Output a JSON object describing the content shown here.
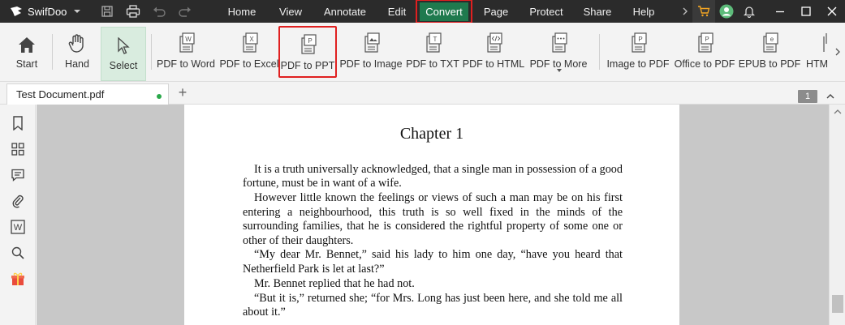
{
  "app": {
    "name": "SwifDoo"
  },
  "menu": {
    "items": [
      {
        "label": "Home"
      },
      {
        "label": "View"
      },
      {
        "label": "Annotate"
      },
      {
        "label": "Edit"
      },
      {
        "label": "Convert",
        "active": true
      },
      {
        "label": "Page"
      },
      {
        "label": "Protect"
      },
      {
        "label": "Share"
      },
      {
        "label": "Help"
      }
    ]
  },
  "ribbon": {
    "start": "Start",
    "hand": "Hand",
    "select": "Select",
    "pdf_to_word": "PDF to Word",
    "pdf_to_excel": "PDF to Excel",
    "pdf_to_ppt": "PDF to PPT",
    "pdf_to_image": "PDF to Image",
    "pdf_to_txt": "PDF to TXT",
    "pdf_to_html": "PDF to HTML",
    "pdf_to_more": "PDF to More",
    "image_to_pdf": "Image to PDF",
    "office_to_pdf": "Office to PDF",
    "epub_to_pdf": "EPUB to PDF",
    "html": "HTM"
  },
  "tabs": {
    "document_tab": "Test Document.pdf",
    "add_tab": "+",
    "page_number": "1"
  },
  "document": {
    "chapter_title": "Chapter 1",
    "paragraphs": [
      "It is a truth universally acknowledged, that a single man in possession of a good fortune, must be in want of a wife.",
      "However little known the feelings or views of such a man may be on his first entering a neighbourhood, this truth is so well fixed in the minds of the surrounding families, that he is considered the rightful property of some one or other of their daughters.",
      "“My dear Mr. Bennet,” said his lady to him one day, “have you heard that Netherfield Park is let at last?”",
      "Mr. Bennet replied that he had not.",
      "“But it is,” returned she; “for Mrs. Long has just been here, and she told me all about it.”"
    ]
  },
  "colors": {
    "accent_green": "#1f7a4e",
    "highlight_red": "#e02020",
    "titlebar": "#2b2b2b"
  },
  "icons": {
    "sidebar": [
      "bookmark-icon",
      "thumbnails-icon",
      "comment-icon",
      "attachment-icon",
      "word-icon",
      "search-icon",
      "gift-icon"
    ]
  }
}
